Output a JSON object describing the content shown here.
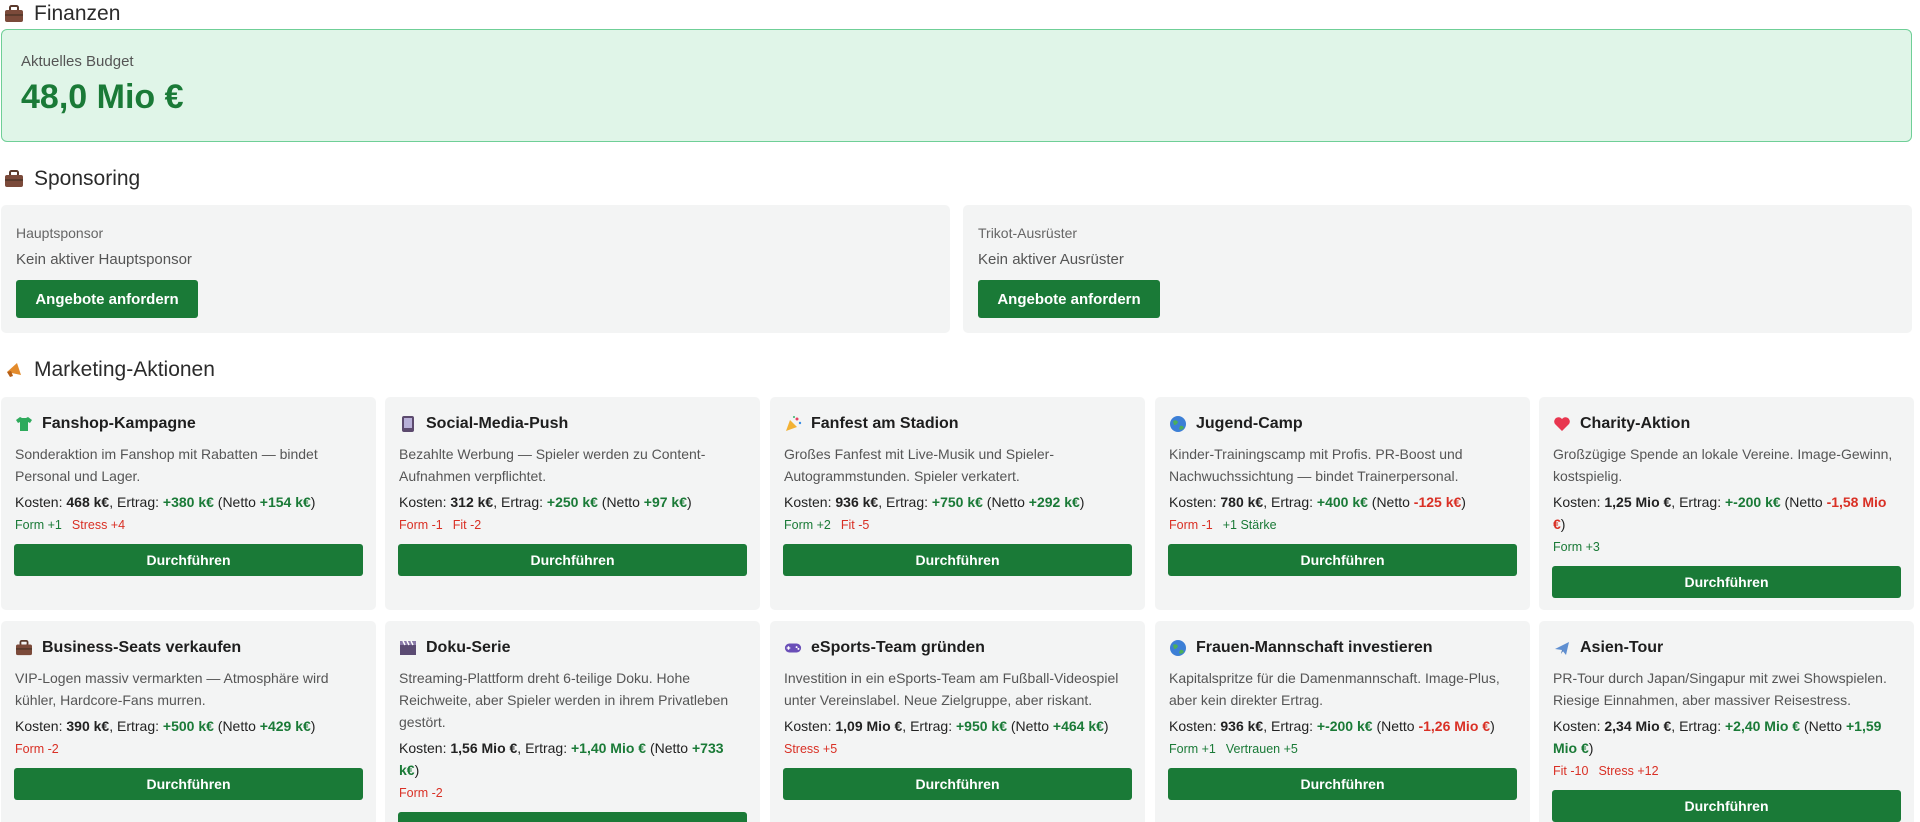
{
  "finance": {
    "title": "Finanzen",
    "budget_label": "Aktuelles Budget",
    "budget_value": "48,0 Mio €"
  },
  "sponsoring": {
    "title": "Sponsoring",
    "main": {
      "type": "Hauptsponsor",
      "status": "Kein aktiver Hauptsponsor",
      "button": "Angebote anfordern"
    },
    "kit": {
      "type": "Trikot-Ausrüster",
      "status": "Kein aktiver Ausrüster",
      "button": "Angebote anfordern"
    }
  },
  "marketing": {
    "title": "Marketing-Aktionen",
    "cost_label": "Kosten: ",
    "revenue_label": ", Ertrag: ",
    "net_label": " (Netto ",
    "net_close": ")",
    "button": "Durchführen",
    "cards": [
      {
        "icon": "shirt-icon",
        "title": "Fanshop-Kampagne",
        "desc": "Sonderaktion im Fanshop mit Rabatten — bindet Personal und Lager.",
        "cost": "468 k€",
        "revenue": "+380 k€",
        "net": "+154 k€",
        "net_type": "pos",
        "effects": [
          {
            "text": "Form +1",
            "type": "pos"
          },
          {
            "text": "Stress +4",
            "type": "neg"
          }
        ]
      },
      {
        "icon": "phone-icon",
        "title": "Social-Media-Push",
        "desc": "Bezahlte Werbung — Spieler werden zu Content-Aufnahmen verpflichtet.",
        "cost": "312 k€",
        "revenue": "+250 k€",
        "net": "+97 k€",
        "net_type": "pos",
        "effects": [
          {
            "text": "Form -1",
            "type": "neg"
          },
          {
            "text": "Fit -2",
            "type": "neg"
          }
        ]
      },
      {
        "icon": "party-icon",
        "title": "Fanfest am Stadion",
        "desc": "Großes Fanfest mit Live-Musik und Spieler-Autogrammstunden. Spieler verkatert.",
        "cost": "936 k€",
        "revenue": "+750 k€",
        "net": "+292 k€",
        "net_type": "pos",
        "effects": [
          {
            "text": "Form +2",
            "type": "pos"
          },
          {
            "text": "Fit -5",
            "type": "neg"
          }
        ]
      },
      {
        "icon": "globe-icon",
        "title": "Jugend-Camp",
        "desc": "Kinder-Trainingscamp mit Profis. PR-Boost und Nachwuchssichtung — bindet Trainerpersonal.",
        "cost": "780 k€",
        "revenue": "+400 k€",
        "net": "-125 k€",
        "net_type": "neg",
        "effects": [
          {
            "text": "Form -1",
            "type": "neg"
          },
          {
            "text": "+1 Stärke",
            "type": "pos"
          }
        ]
      },
      {
        "icon": "heart-icon",
        "title": "Charity-Aktion",
        "desc": "Großzügige Spende an lokale Vereine. Image-Gewinn, kostspielig.",
        "cost": "1,25 Mio €",
        "revenue": "+-200 k€",
        "net": "-1,58 Mio €",
        "net_type": "neg",
        "effects": [
          {
            "text": "Form +3",
            "type": "pos"
          }
        ]
      },
      {
        "icon": "briefcase-icon",
        "title": "Business-Seats verkaufen",
        "desc": "VIP-Logen massiv vermarkten — Atmosphäre wird kühler, Hardcore-Fans murren.",
        "cost": "390 k€",
        "revenue": "+500 k€",
        "net": "+429 k€",
        "net_type": "pos",
        "effects": [
          {
            "text": "Form -2",
            "type": "neg"
          }
        ]
      },
      {
        "icon": "clapper-icon",
        "title": "Doku-Serie",
        "desc": "Streaming-Plattform dreht 6-teilige Doku. Hohe Reichweite, aber Spieler werden in ihrem Privatleben gestört.",
        "cost": "1,56 Mio €",
        "revenue": "+1,40 Mio €",
        "net": "+733 k€",
        "net_type": "pos",
        "effects": [
          {
            "text": "Form -2",
            "type": "neg"
          }
        ]
      },
      {
        "icon": "gamepad-icon",
        "title": "eSports-Team gründen",
        "desc": "Investition in ein eSports-Team am Fußball-Videospiel unter Vereinslabel. Neue Zielgruppe, aber riskant.",
        "cost": "1,09 Mio €",
        "revenue": "+950 k€",
        "net": "+464 k€",
        "net_type": "pos",
        "effects": [
          {
            "text": "Stress +5",
            "type": "neg"
          }
        ]
      },
      {
        "icon": "globe-icon",
        "title": "Frauen-Mannschaft investieren",
        "desc": "Kapitalspritze für die Damenmannschaft. Image-Plus, aber kein direkter Ertrag.",
        "cost": "936 k€",
        "revenue": "+-200 k€",
        "net": "-1,26 Mio €",
        "net_type": "neg",
        "effects": [
          {
            "text": "Form +1",
            "type": "pos"
          },
          {
            "text": "Vertrauen +5",
            "type": "pos"
          }
        ]
      },
      {
        "icon": "airplane-icon",
        "title": "Asien-Tour",
        "desc": "PR-Tour durch Japan/Singapur mit zwei Showspielen. Riesige Einnahmen, aber massiver Reisestress.",
        "cost": "2,34 Mio €",
        "revenue": "+2,40 Mio €",
        "net": "+1,59 Mio €",
        "net_type": "pos",
        "effects": [
          {
            "text": "Fit -10",
            "type": "neg"
          },
          {
            "text": "Stress +12",
            "type": "neg"
          }
        ]
      }
    ]
  },
  "colors": {
    "accent": "#1a7a37",
    "negative": "#d93025",
    "budget_bg": "#e0f5e8",
    "card_bg": "#f3f4f4"
  }
}
